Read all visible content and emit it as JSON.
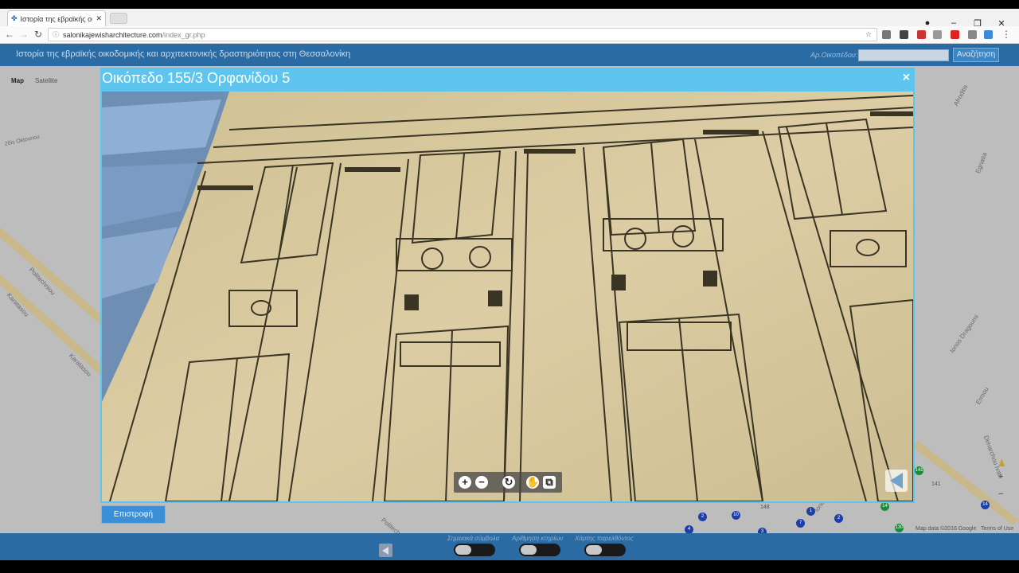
{
  "browser": {
    "tab_title": "Ιστορία της εβραϊκής οι",
    "url_host": "salonikajewisharchitecture.com",
    "url_path": "/index_gr.php"
  },
  "header": {
    "title": "Ιστορία της εβραϊκής οικοδομικής και αρχιτεκτονικής δραστηριότητας στη Θεσσαλονίκη",
    "search_label": "Αρ.Οικοπέδου:",
    "search_button": "Αναζήτηση"
  },
  "map": {
    "tabs": [
      "Map",
      "Satellite"
    ],
    "streets": [
      "Politechniou",
      "Karatasou",
      "Karatasou",
      "Politechniou",
      "Ionos Dragoumi",
      "Ionos Dragoumi",
      "Dimarchou Ivan",
      "Ermou",
      "Egnatia",
      "Afroditis"
    ],
    "pins": [
      "2",
      "10",
      "1",
      "7",
      "2",
      "14",
      "141",
      "148",
      "141",
      "14",
      "4",
      "3",
      "130"
    ],
    "footer": "Map data ©2016 Google",
    "terms": "Terms of Use"
  },
  "modal": {
    "title": "Οικόπεδο 155/3 Ορφανίδου 5",
    "close": "×",
    "back_button": "Επιστροφή"
  },
  "footer": {
    "labels": [
      "Σημειακά σύμβολα",
      "Αρίθμηση κτηρίων",
      "Χάρτης παρελθόντος"
    ]
  },
  "colors": {
    "header_blue": "#2a6ba3",
    "modal_border": "#5ec6ee",
    "button_blue": "#3a8fd6",
    "drawing_paper": "#d7c9a0"
  }
}
